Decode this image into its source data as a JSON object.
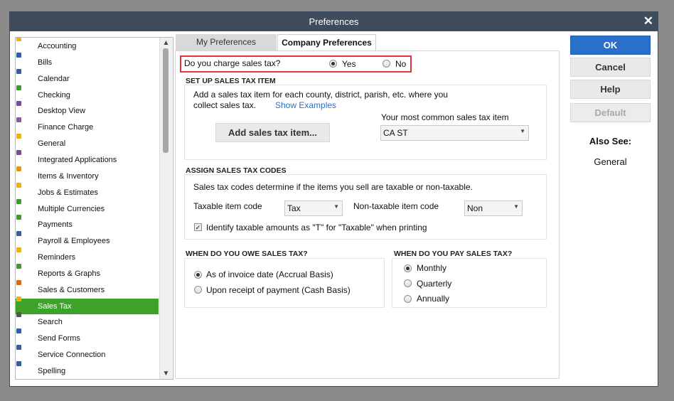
{
  "window": {
    "title": "Preferences"
  },
  "categories": [
    {
      "label": "Accounting",
      "icon": "accounting-icon",
      "color": "#f2b200"
    },
    {
      "label": "Bills",
      "icon": "bills-icon",
      "color": "#2f5fa8"
    },
    {
      "label": "Calendar",
      "icon": "calendar-icon",
      "color": "#2f5fa8"
    },
    {
      "label": "Checking",
      "icon": "checking-icon",
      "color": "#3f9a2f"
    },
    {
      "label": "Desktop View",
      "icon": "desktop-view-icon",
      "color": "#7a4aa0"
    },
    {
      "label": "Finance Charge",
      "icon": "finance-charge-icon",
      "color": "#8a5aa8"
    },
    {
      "label": "General",
      "icon": "general-icon",
      "color": "#f2b200"
    },
    {
      "label": "Integrated Applications",
      "icon": "integrated-applications-icon",
      "color": "#7a4aa0"
    },
    {
      "label": "Items & Inventory",
      "icon": "items-inventory-icon",
      "color": "#e39a00"
    },
    {
      "label": "Jobs & Estimates",
      "icon": "jobs-estimates-icon",
      "color": "#f2b200"
    },
    {
      "label": "Multiple Currencies",
      "icon": "multiple-currencies-icon",
      "color": "#3f9a2f"
    },
    {
      "label": "Payments",
      "icon": "payments-icon",
      "color": "#3f9a2f"
    },
    {
      "label": "Payroll & Employees",
      "icon": "payroll-employees-icon",
      "color": "#2f5fa8"
    },
    {
      "label": "Reminders",
      "icon": "reminders-icon",
      "color": "#f2b200"
    },
    {
      "label": "Reports & Graphs",
      "icon": "reports-graphs-icon",
      "color": "#3f9a2f"
    },
    {
      "label": "Sales & Customers",
      "icon": "sales-customers-icon",
      "color": "#d96b00"
    },
    {
      "label": "Sales Tax",
      "icon": "sales-tax-icon",
      "color": "#f2b200"
    },
    {
      "label": "Search",
      "icon": "search-icon",
      "color": "#555555"
    },
    {
      "label": "Send Forms",
      "icon": "send-forms-icon",
      "color": "#2f5fa8"
    },
    {
      "label": "Service Connection",
      "icon": "service-connection-icon",
      "color": "#2f5fa8"
    },
    {
      "label": "Spelling",
      "icon": "spelling-icon",
      "color": "#2f5fa8"
    }
  ],
  "selected_category": "Sales Tax",
  "tabs": {
    "my": "My Preferences",
    "company": "Company Preferences"
  },
  "charge": {
    "question": "Do you charge sales tax?",
    "yes": "Yes",
    "no": "No",
    "selected": "Yes"
  },
  "setup": {
    "heading": "SET UP SALES TAX ITEM",
    "line1": "Add a sales tax item for each county, district, parish, etc. where you",
    "line2": "collect sales tax.",
    "link": "Show Examples",
    "add_button": "Add sales tax item...",
    "common_label": "Your most common sales tax item",
    "common_value": "CA ST"
  },
  "codes": {
    "heading": "ASSIGN SALES TAX CODES",
    "desc": "Sales tax codes determine if the items you sell are taxable or non-taxable.",
    "taxable_label": "Taxable item code",
    "taxable_value": "Tax",
    "nontaxable_label": "Non-taxable item code",
    "nontaxable_value": "Non",
    "identify_label": "Identify taxable amounts as \"T\" for \"Taxable\" when printing",
    "identify_checked": true
  },
  "owe": {
    "heading": "WHEN DO YOU OWE SALES TAX?",
    "options": [
      "As of invoice date (Accrual Basis)",
      "Upon receipt of payment (Cash Basis)"
    ],
    "selected": "As of invoice date (Accrual Basis)"
  },
  "pay": {
    "heading": "WHEN DO YOU PAY SALES TAX?",
    "options": [
      "Monthly",
      "Quarterly",
      "Annually"
    ],
    "selected": "Monthly"
  },
  "buttons": {
    "ok": "OK",
    "cancel": "Cancel",
    "help": "Help",
    "default": "Default"
  },
  "also_see": {
    "heading": "Also See:",
    "link": "General"
  }
}
